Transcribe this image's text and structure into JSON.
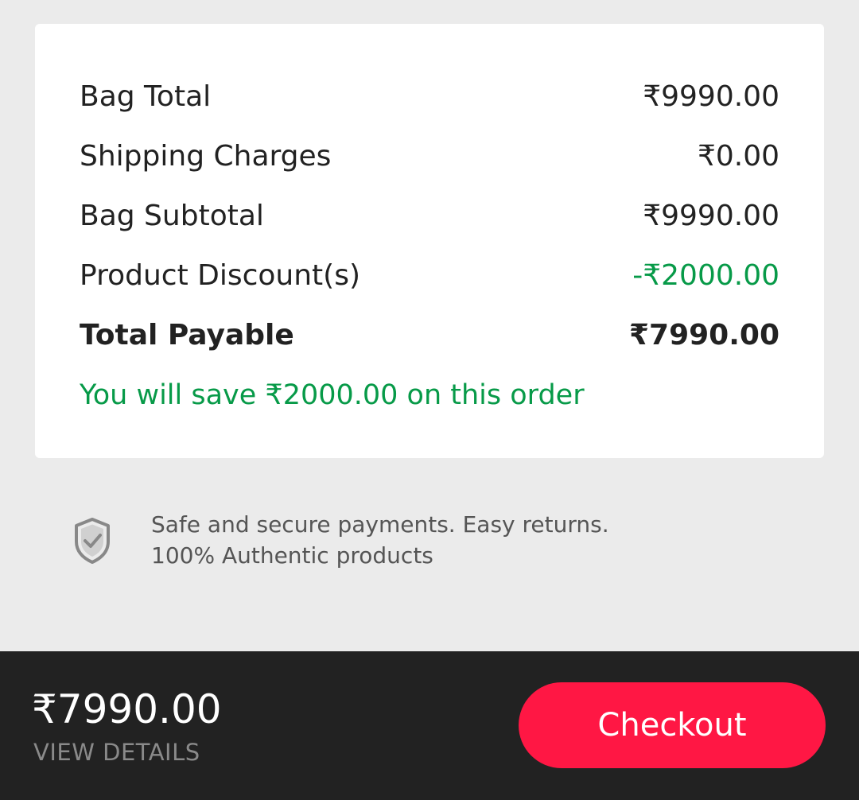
{
  "summary": {
    "rows": [
      {
        "label": "Bag Total",
        "value": "₹9990.00"
      },
      {
        "label": "Shipping Charges",
        "value": "₹0.00"
      },
      {
        "label": "Bag Subtotal",
        "value": "₹9990.00"
      },
      {
        "label": "Product Discount(s)",
        "value": "-₹2000.00"
      },
      {
        "label": "Total Payable",
        "value": "₹7990.00"
      }
    ],
    "savings_text": "You will save ₹2000.00 on this order"
  },
  "trust": {
    "icon": "shield-check-icon",
    "line1": "Safe and secure payments. Easy returns.",
    "line2": "100% Authentic products"
  },
  "footer": {
    "price": "₹7990.00",
    "view_details": "VIEW DETAILS",
    "checkout_label": "Checkout"
  },
  "colors": {
    "accent": "#ff1744",
    "savings_green": "#079a48",
    "footer_bg": "#222222",
    "page_bg": "#ebebeb"
  }
}
